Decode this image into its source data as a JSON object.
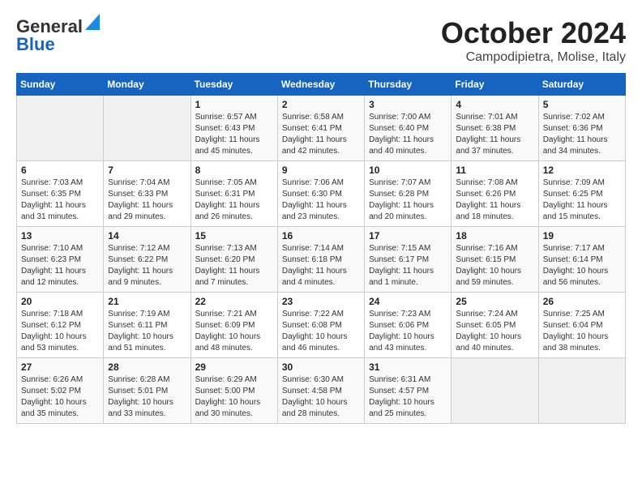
{
  "header": {
    "logo": {
      "line1": "General",
      "line2": "Blue"
    },
    "title": "October 2024",
    "subtitle": "Campodipietra, Molise, Italy"
  },
  "weekdays": [
    "Sunday",
    "Monday",
    "Tuesday",
    "Wednesday",
    "Thursday",
    "Friday",
    "Saturday"
  ],
  "weeks": [
    [
      {
        "day": "",
        "info": ""
      },
      {
        "day": "",
        "info": ""
      },
      {
        "day": "1",
        "info": "Sunrise: 6:57 AM\nSunset: 6:43 PM\nDaylight: 11 hours and 45 minutes."
      },
      {
        "day": "2",
        "info": "Sunrise: 6:58 AM\nSunset: 6:41 PM\nDaylight: 11 hours and 42 minutes."
      },
      {
        "day": "3",
        "info": "Sunrise: 7:00 AM\nSunset: 6:40 PM\nDaylight: 11 hours and 40 minutes."
      },
      {
        "day": "4",
        "info": "Sunrise: 7:01 AM\nSunset: 6:38 PM\nDaylight: 11 hours and 37 minutes."
      },
      {
        "day": "5",
        "info": "Sunrise: 7:02 AM\nSunset: 6:36 PM\nDaylight: 11 hours and 34 minutes."
      }
    ],
    [
      {
        "day": "6",
        "info": "Sunrise: 7:03 AM\nSunset: 6:35 PM\nDaylight: 11 hours and 31 minutes."
      },
      {
        "day": "7",
        "info": "Sunrise: 7:04 AM\nSunset: 6:33 PM\nDaylight: 11 hours and 29 minutes."
      },
      {
        "day": "8",
        "info": "Sunrise: 7:05 AM\nSunset: 6:31 PM\nDaylight: 11 hours and 26 minutes."
      },
      {
        "day": "9",
        "info": "Sunrise: 7:06 AM\nSunset: 6:30 PM\nDaylight: 11 hours and 23 minutes."
      },
      {
        "day": "10",
        "info": "Sunrise: 7:07 AM\nSunset: 6:28 PM\nDaylight: 11 hours and 20 minutes."
      },
      {
        "day": "11",
        "info": "Sunrise: 7:08 AM\nSunset: 6:26 PM\nDaylight: 11 hours and 18 minutes."
      },
      {
        "day": "12",
        "info": "Sunrise: 7:09 AM\nSunset: 6:25 PM\nDaylight: 11 hours and 15 minutes."
      }
    ],
    [
      {
        "day": "13",
        "info": "Sunrise: 7:10 AM\nSunset: 6:23 PM\nDaylight: 11 hours and 12 minutes."
      },
      {
        "day": "14",
        "info": "Sunrise: 7:12 AM\nSunset: 6:22 PM\nDaylight: 11 hours and 9 minutes."
      },
      {
        "day": "15",
        "info": "Sunrise: 7:13 AM\nSunset: 6:20 PM\nDaylight: 11 hours and 7 minutes."
      },
      {
        "day": "16",
        "info": "Sunrise: 7:14 AM\nSunset: 6:18 PM\nDaylight: 11 hours and 4 minutes."
      },
      {
        "day": "17",
        "info": "Sunrise: 7:15 AM\nSunset: 6:17 PM\nDaylight: 11 hours and 1 minute."
      },
      {
        "day": "18",
        "info": "Sunrise: 7:16 AM\nSunset: 6:15 PM\nDaylight: 10 hours and 59 minutes."
      },
      {
        "day": "19",
        "info": "Sunrise: 7:17 AM\nSunset: 6:14 PM\nDaylight: 10 hours and 56 minutes."
      }
    ],
    [
      {
        "day": "20",
        "info": "Sunrise: 7:18 AM\nSunset: 6:12 PM\nDaylight: 10 hours and 53 minutes."
      },
      {
        "day": "21",
        "info": "Sunrise: 7:19 AM\nSunset: 6:11 PM\nDaylight: 10 hours and 51 minutes."
      },
      {
        "day": "22",
        "info": "Sunrise: 7:21 AM\nSunset: 6:09 PM\nDaylight: 10 hours and 48 minutes."
      },
      {
        "day": "23",
        "info": "Sunrise: 7:22 AM\nSunset: 6:08 PM\nDaylight: 10 hours and 46 minutes."
      },
      {
        "day": "24",
        "info": "Sunrise: 7:23 AM\nSunset: 6:06 PM\nDaylight: 10 hours and 43 minutes."
      },
      {
        "day": "25",
        "info": "Sunrise: 7:24 AM\nSunset: 6:05 PM\nDaylight: 10 hours and 40 minutes."
      },
      {
        "day": "26",
        "info": "Sunrise: 7:25 AM\nSunset: 6:04 PM\nDaylight: 10 hours and 38 minutes."
      }
    ],
    [
      {
        "day": "27",
        "info": "Sunrise: 6:26 AM\nSunset: 5:02 PM\nDaylight: 10 hours and 35 minutes."
      },
      {
        "day": "28",
        "info": "Sunrise: 6:28 AM\nSunset: 5:01 PM\nDaylight: 10 hours and 33 minutes."
      },
      {
        "day": "29",
        "info": "Sunrise: 6:29 AM\nSunset: 5:00 PM\nDaylight: 10 hours and 30 minutes."
      },
      {
        "day": "30",
        "info": "Sunrise: 6:30 AM\nSunset: 4:58 PM\nDaylight: 10 hours and 28 minutes."
      },
      {
        "day": "31",
        "info": "Sunrise: 6:31 AM\nSunset: 4:57 PM\nDaylight: 10 hours and 25 minutes."
      },
      {
        "day": "",
        "info": ""
      },
      {
        "day": "",
        "info": ""
      }
    ]
  ]
}
